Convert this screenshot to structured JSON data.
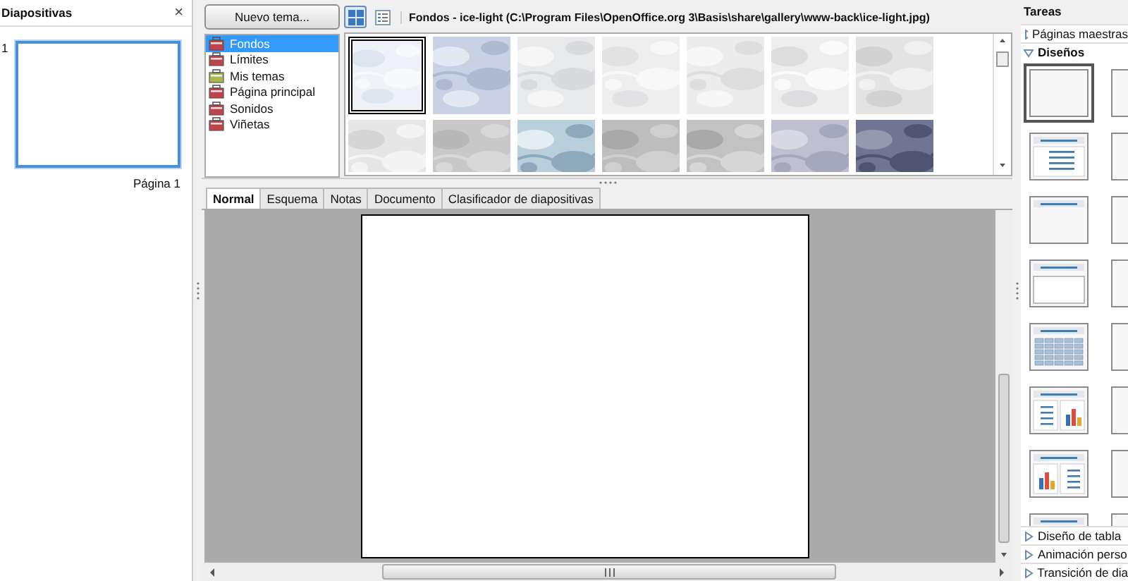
{
  "slides_pane": {
    "title": "Diapositivas",
    "close": "×",
    "slides": [
      {
        "number": "1",
        "label": "Página 1",
        "selected": true
      }
    ]
  },
  "gallery": {
    "new_theme_button": "Nuevo tema...",
    "themes": [
      {
        "label": "Fondos",
        "selected": true,
        "color": "#c0424a"
      },
      {
        "label": "Límites",
        "selected": false,
        "color": "#c0424a"
      },
      {
        "label": "Mis temas",
        "selected": false,
        "color": "#a9b84a"
      },
      {
        "label": "Página principal",
        "selected": false,
        "color": "#c0424a"
      },
      {
        "label": "Sonidos",
        "selected": false,
        "color": "#c0424a"
      },
      {
        "label": "Viñetas",
        "selected": false,
        "color": "#c0424a"
      }
    ],
    "view_modes": [
      {
        "kind": "icons",
        "selected": true
      },
      {
        "kind": "details",
        "selected": false
      }
    ],
    "path_title": "Fondos - ice-light (C:\\Program Files\\OpenOffice.org 3\\Basis\\share\\gallery\\www-back\\ice-light.jpg)",
    "items": [
      {
        "kind": "picture",
        "selected": true
      },
      {
        "kind": "picture",
        "selected": false
      },
      {
        "kind": "picture",
        "selected": false
      },
      {
        "kind": "picture",
        "selected": false
      },
      {
        "kind": "picture",
        "selected": false
      },
      {
        "kind": "picture",
        "selected": false
      },
      {
        "kind": "picture",
        "selected": false
      },
      {
        "kind": "picture",
        "selected": false
      },
      {
        "kind": "picture",
        "selected": false
      },
      {
        "kind": "picture",
        "selected": false
      },
      {
        "kind": "picture",
        "selected": false
      },
      {
        "kind": "picture",
        "selected": false
      },
      {
        "kind": "picture",
        "selected": false
      },
      {
        "kind": "picture",
        "selected": false
      }
    ]
  },
  "view_tabs": [
    {
      "label": "Normal",
      "selected": true
    },
    {
      "label": "Esquema",
      "selected": false
    },
    {
      "label": "Notas",
      "selected": false
    },
    {
      "label": "Documento",
      "selected": false
    },
    {
      "label": "Clasificador de diapositivas",
      "selected": false
    }
  ],
  "tasks_pane": {
    "title": "Tareas",
    "sections_top": [
      {
        "label": "Páginas maestras",
        "expanded": false
      },
      {
        "label": "Diseños",
        "expanded": true
      }
    ],
    "layouts": [
      {
        "kind": "blank",
        "selected": true
      },
      {
        "kind": "frame",
        "selected": false
      },
      {
        "kind": "title-list",
        "selected": false
      },
      {
        "kind": "frame",
        "selected": false
      },
      {
        "kind": "title-only",
        "selected": false
      },
      {
        "kind": "frame",
        "selected": false
      },
      {
        "kind": "title-box",
        "selected": false
      },
      {
        "kind": "frame",
        "selected": false
      },
      {
        "kind": "title-table",
        "selected": false
      },
      {
        "kind": "frame",
        "selected": false
      },
      {
        "kind": "title-list-chart",
        "selected": false
      },
      {
        "kind": "frame",
        "selected": false
      },
      {
        "kind": "title-chart-list",
        "selected": false
      },
      {
        "kind": "frame",
        "selected": false
      },
      {
        "kind": "title-only",
        "selected": false
      },
      {
        "kind": "frame",
        "selected": false
      }
    ],
    "sections_bottom": [
      {
        "label": "Diseño de tabla",
        "expanded": false
      },
      {
        "label": "Animación perso",
        "expanded": false
      },
      {
        "label": "Transición de dia",
        "expanded": false
      }
    ]
  }
}
